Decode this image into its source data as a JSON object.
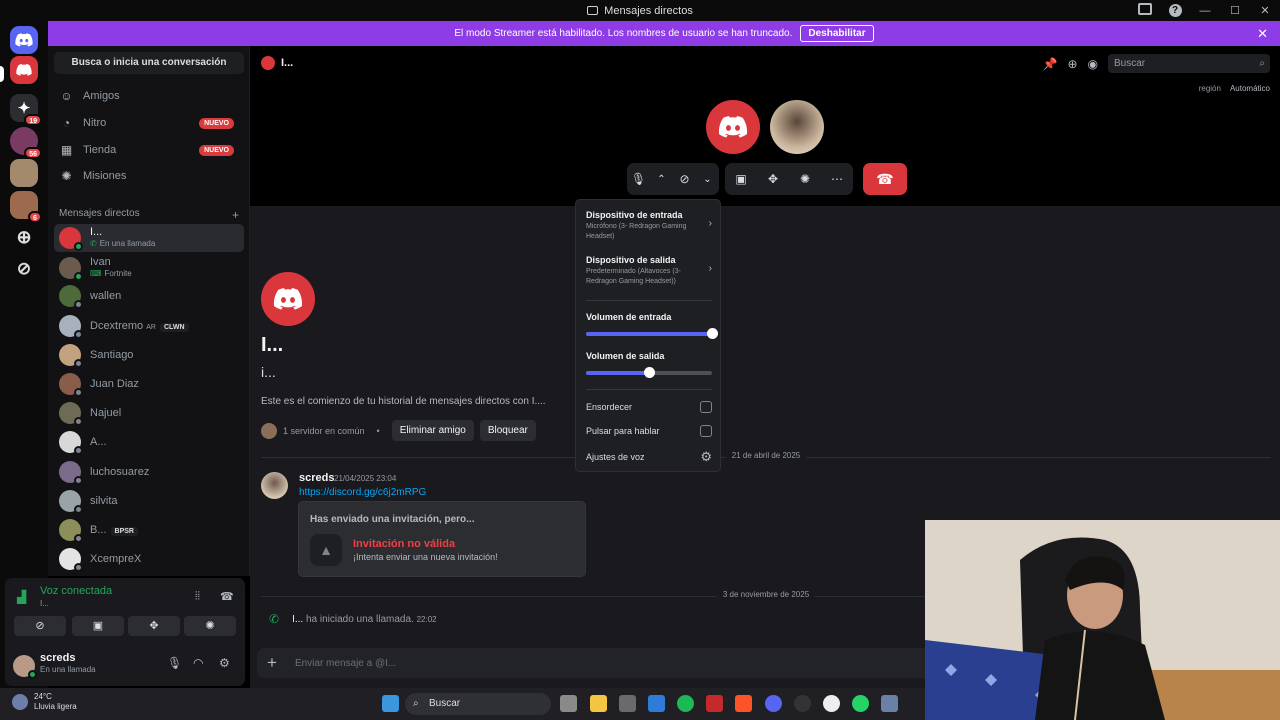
{
  "window": {
    "title": "Mensajes directos"
  },
  "banner": {
    "text": "El modo Streamer está habilitado. Los nombres de usuario se han truncado.",
    "button": "Deshabilitar"
  },
  "servers": {
    "badges": [
      "19",
      "56",
      "6"
    ]
  },
  "sidebar": {
    "search_button": "Busca o inicia una conversación",
    "nav": [
      {
        "label": "Amigos",
        "icon": "friends-icon"
      },
      {
        "label": "Nitro",
        "icon": "nitro-icon",
        "badge": "NUEVO"
      },
      {
        "label": "Tienda",
        "icon": "shop-icon",
        "badge": "NUEVO"
      },
      {
        "label": "Misiones",
        "icon": "quests-icon"
      }
    ],
    "dm_header": "Mensajes directos",
    "dms": [
      {
        "name": "I...",
        "sub": "En una llamada"
      },
      {
        "name": "Ivan",
        "sub": "Fortnite"
      },
      {
        "name": "wallen"
      },
      {
        "name": "Dcextremo",
        "tag1": "AR",
        "tag2": "CLWN"
      },
      {
        "name": "Santiago"
      },
      {
        "name": "Juan Diaz"
      },
      {
        "name": "Najuel"
      },
      {
        "name": "A..."
      },
      {
        "name": "luchosuarez"
      },
      {
        "name": "silvita"
      },
      {
        "name": "B...",
        "tag2": "BPSR"
      },
      {
        "name": "XcempreX"
      }
    ]
  },
  "voice": {
    "status": "Voz conectada",
    "channel": "I...",
    "user": "screds",
    "user_status": "En una llamada"
  },
  "header": {
    "channel_name": "I...",
    "search_placeholder": "Buscar",
    "region_label": "región",
    "region_value": "Automático"
  },
  "popup": {
    "input_title": "Dispositivo de entrada",
    "input_sub": "Micrófono (3- Redragon Gaming Headset)",
    "output_title": "Dispositivo de salida",
    "output_sub": "Predeterminado (Altavoces (3- Redragon Gaming Headset))",
    "input_volume_label": "Volumen de entrada",
    "input_volume": 1.0,
    "output_volume_label": "Volumen de salida",
    "output_volume": 0.5,
    "deafen": "Ensordecer",
    "ptt": "Pulsar para hablar",
    "settings": "Ajustes de voz"
  },
  "welcome": {
    "name": "I...",
    "username": "i...",
    "description": "Este es el comienzo de tu historial de mensajes directos con I....",
    "mutual": "1 servidor en común",
    "remove": "Eliminar amigo",
    "block": "Bloquear"
  },
  "messages": {
    "date1": "21 de abril de 2025",
    "author": "screds",
    "time": "21/04/2025 23:04",
    "link": "https://discord.gg/c6j2mRPG",
    "invite_head": "Has enviado una invitación, pero...",
    "invite_title": "Invitación no válida",
    "invite_sub": "¡Intenta enviar una nueva invitación!",
    "date2": "3 de noviembre de 2025",
    "call_user": "I...",
    "call_text": "ha iniciado una llamada.",
    "call_time": "22:02",
    "composer_placeholder": "Enviar mensaje a @I..."
  },
  "taskbar": {
    "temp": "24°C",
    "weather": "Lluvia ligera",
    "search": "Buscar"
  },
  "colors": {
    "banner": "#8e3de6",
    "accent": "#5865f2",
    "danger": "#da373c",
    "online": "#23a55a"
  }
}
